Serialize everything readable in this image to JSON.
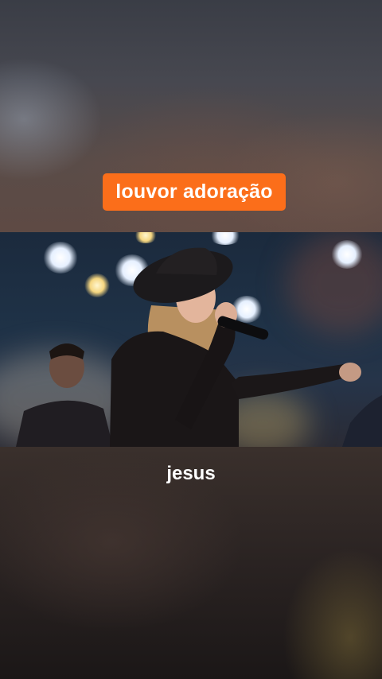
{
  "overlay": {
    "title": "louvor adoração",
    "caption": "jesus"
  },
  "colors": {
    "title_badge": "#fb6e1a",
    "caption_text": "#ffffff"
  },
  "video": {
    "description_icon": "video-frame"
  }
}
